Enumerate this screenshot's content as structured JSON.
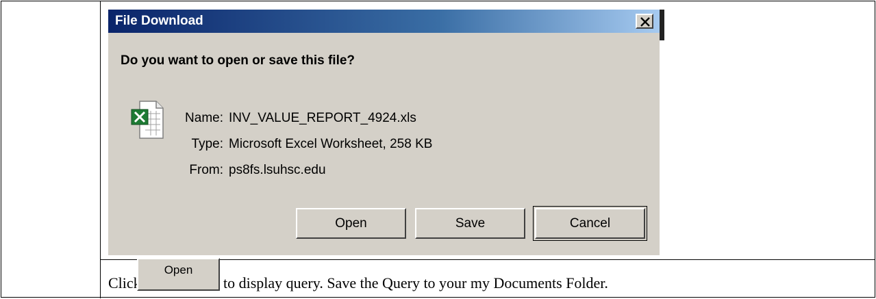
{
  "dialog": {
    "title": "File Download",
    "question": "Do you want to open or save this file?",
    "file_icon": "excel-file-icon",
    "info": [
      {
        "label": "Name:",
        "value": "INV_VALUE_REPORT_4924.xls"
      },
      {
        "label": "Type:",
        "value": "Microsoft Excel Worksheet, 258 KB"
      },
      {
        "label": "From:",
        "value": "ps8fs.lsuhsc.edu"
      }
    ],
    "buttons": {
      "open": "Open",
      "save": "Save",
      "cancel": "Cancel"
    },
    "close_icon": "close-icon"
  },
  "caption": {
    "prefix": "Click",
    "button_label": "Open",
    "suffix": "to display query. Save the Query to your my Documents Folder."
  },
  "colors": {
    "dialog_bg": "#d4d0c8",
    "titlebar_start": "#0a246a",
    "titlebar_end": "#a6caf0",
    "excel_green": "#1e7b34"
  }
}
